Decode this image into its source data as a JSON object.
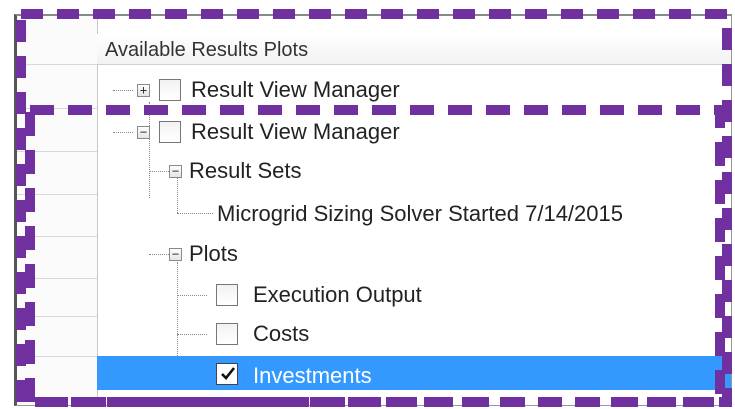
{
  "header": {
    "title": "Available Results Plots"
  },
  "tree": {
    "item_collapsed": {
      "label": "Result View Manager"
    },
    "item_expanded": {
      "label": "Result View Manager"
    },
    "result_sets": {
      "label": "Result Sets"
    },
    "result_set_item": {
      "label": "Microgrid Sizing Solver Started 7/14/2015"
    },
    "plots": {
      "label": "Plots"
    },
    "execution_output": {
      "label": "Execution Output",
      "checked": false
    },
    "costs": {
      "label": "Costs",
      "checked": false
    },
    "investments": {
      "label": "Investments",
      "checked": true
    }
  },
  "colors": {
    "highlight_box": "#7030a0",
    "selection": "#3399ff"
  }
}
